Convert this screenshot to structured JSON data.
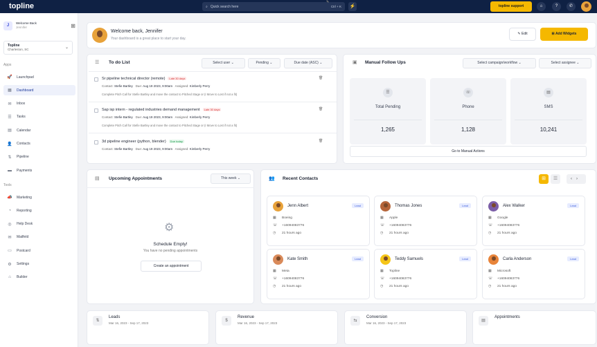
{
  "topbar": {
    "logo": "topline",
    "search_placeholder": "Quick search here",
    "search_shortcut": "Ctrl + K",
    "bolt_icon": "⚡",
    "support_label": "topline support"
  },
  "sidebar": {
    "user_title": "Welcome Back",
    "user_name": "Jennifer",
    "avatar_letter": "J",
    "location_name": "Topline",
    "location_sub": "Charleston, SC",
    "apps_label": "Apps",
    "tools_label": "Tools",
    "apps": [
      {
        "label": "Launchpad",
        "icon": "🚀"
      },
      {
        "label": "Dashboard",
        "icon": "▦"
      },
      {
        "label": "Inbox",
        "icon": "✉"
      },
      {
        "label": "Tasks",
        "icon": "☰"
      },
      {
        "label": "Calendar",
        "icon": "▤"
      },
      {
        "label": "Contacts",
        "icon": "👤"
      },
      {
        "label": "Pipeline",
        "icon": "⇅"
      },
      {
        "label": "Payments",
        "icon": "▬"
      }
    ],
    "tools": [
      {
        "label": "Marketing",
        "icon": "📣"
      },
      {
        "label": "Reporting",
        "icon": "◔"
      },
      {
        "label": "Help Desk",
        "icon": "◎"
      },
      {
        "label": "Mailfeld",
        "icon": "✉"
      },
      {
        "label": "Postcard",
        "icon": "▭"
      },
      {
        "label": "Settings",
        "icon": "⚙"
      },
      {
        "label": "Builder",
        "icon": "⌂"
      }
    ]
  },
  "welcome": {
    "title": "Welcome back, Jennifer",
    "subtitle": "Your dashboard is a great place to start your day.",
    "edit_label": "Edit",
    "add_widgets_label": "Add Widgets"
  },
  "todo": {
    "title": "To do List",
    "filter_user": "Select user",
    "filter_status": "Pending",
    "filter_sort": "Due date (ASC)",
    "tasks": [
      {
        "title": "Sr pipeline technical director (remote)",
        "badge": "Late 30 days",
        "contact": "Stefie Bartley",
        "due": "Aug 19 2023, 9:00am",
        "assigned": "Kimberly Perry",
        "desc": "Complete Pitch Call for Stefie Bartley and move the contact to Pitched Stage or (I Move to Lost if not a fit)"
      },
      {
        "title": "Sap isp intern - regulated industries demand management",
        "badge": "Late 30 days",
        "contact": "Stefie Bartley",
        "due": "Aug 19 2023, 9:00am",
        "assigned": "Kimberly Perry",
        "desc": "Complete Pitch Call for Stefie Bartley and move the contact to Pitched Stage or (I Move to Lost if not a fit)"
      },
      {
        "title": "3d pipeline engineer (python, blender)",
        "badge": "Due today",
        "contact": "Stefie Bartley",
        "due": "Aug 19 2023, 9:00am",
        "assigned": "Kimberly Perry",
        "desc": ""
      }
    ],
    "contact_label": "Contact:",
    "due_label": "Due:",
    "assigned_label": "Assigned:"
  },
  "followups": {
    "title": "Manual Follow Ups",
    "filter_campaign": "Select campaign/workflow",
    "filter_assignee": "Select assignee",
    "boxes": [
      {
        "label": "Total Pending",
        "value": "1,265",
        "icon": "☰"
      },
      {
        "label": "Phone",
        "value": "1,128",
        "icon": "☏"
      },
      {
        "label": "SMS",
        "value": "10,241",
        "icon": "▤"
      }
    ],
    "goto_label": "Go to Manual Actions"
  },
  "appointments": {
    "title": "Upcoming Appointments",
    "filter": "This week",
    "empty_title": "Schedule Empty!",
    "empty_sub": "You have no pending appointments",
    "create_label": "Create an appointment"
  },
  "contacts": {
    "title": "Recent Contacts",
    "lead_label": "Lead",
    "items": [
      {
        "name": "Jenn Albert",
        "company": "Boeing",
        "phone": "+16094083776",
        "time": "21 hours ago",
        "color": "#e8a23a"
      },
      {
        "name": "Thomas Jones",
        "company": "Apple",
        "phone": "+16094083776",
        "time": "21 hours ago",
        "color": "#b5653a"
      },
      {
        "name": "Alex Walker",
        "company": "Google",
        "phone": "+16094083776",
        "time": "21 hours ago",
        "color": "#7b5ea7"
      },
      {
        "name": "Kate Smith",
        "company": "Meta",
        "phone": "+16094083776",
        "time": "21 hours ago",
        "color": "#d98a5a"
      },
      {
        "name": "Teddy Samuels",
        "company": "Topline",
        "phone": "+16094083776",
        "time": "21 hours ago",
        "color": "#f5c518"
      },
      {
        "name": "Carla Anderson",
        "company": "Microsoft",
        "phone": "+16094083776",
        "time": "21 hours ago",
        "color": "#e8843a"
      }
    ]
  },
  "stats": [
    {
      "title": "Leads",
      "sub": "Mar 16, 2023 - Sep 17, 2023",
      "icon": "⇅"
    },
    {
      "title": "Revenue",
      "sub": "Mar 16, 2023 - Sep 17, 2023",
      "icon": "$"
    },
    {
      "title": "Conversion",
      "sub": "Mar 16, 2023 - Sep 17, 2023",
      "icon": "⇆"
    },
    {
      "title": "Appointments",
      "sub": "",
      "icon": "▤"
    }
  ]
}
